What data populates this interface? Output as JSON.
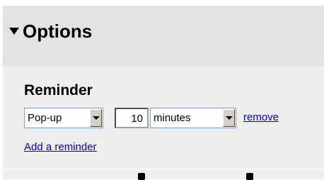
{
  "options": {
    "title": "Options",
    "reminder": {
      "heading": "Reminder",
      "type_value": "Pop-up",
      "amount_value": "10",
      "unit_value": "minutes",
      "remove_label": "remove",
      "add_label": "Add a reminder"
    }
  }
}
